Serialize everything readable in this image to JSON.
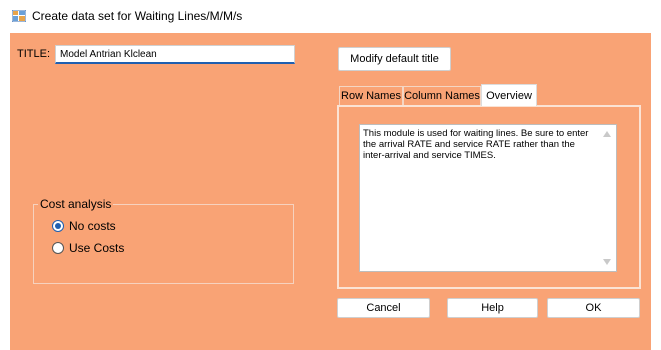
{
  "window": {
    "title": "Create data set for Waiting Lines/M/M/s",
    "icon": "data-grid-icon"
  },
  "form": {
    "title_label": "TITLE:",
    "title_value": "Model Antrian Klclean",
    "modify_button": "Modify default title"
  },
  "tabs": {
    "items": [
      "Row Names",
      "Column Names",
      "Overview"
    ],
    "selected": "Overview",
    "overview_text": "This module is used for waiting lines. Be sure to enter the arrival RATE and service RATE rather than the inter-arrival and service TIMES."
  },
  "cost_analysis": {
    "label": "Cost analysis",
    "options": [
      "No costs",
      "Use Costs"
    ],
    "selected": "No costs"
  },
  "buttons": {
    "cancel": "Cancel",
    "help": "Help",
    "ok": "OK"
  },
  "colors": {
    "dialog_background": "#f9a375",
    "accent": "#1f5fb0"
  }
}
